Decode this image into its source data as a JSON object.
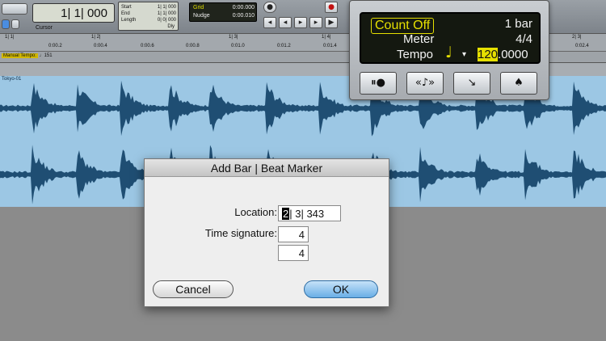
{
  "toolbar": {
    "main_counter": "1| 1| 000",
    "cursor_label": "Cursor",
    "selection": [
      {
        "label": "Start",
        "value": "1| 1| 000"
      },
      {
        "label": "End",
        "value": "1| 1| 000"
      },
      {
        "label": "Length",
        "value": "0| 0| 000"
      }
    ],
    "dly_label": "Dly",
    "grid": {
      "label": "Grid",
      "value": "0:00.000"
    },
    "nudge": {
      "label": "Nudge",
      "value": "0:00.010"
    }
  },
  "ruler": {
    "bars": [
      "1| 1|",
      "1| 2|",
      "1| 3|",
      "1| 4|",
      "2| 3|"
    ],
    "times": [
      "0:00.2",
      "0:00.4",
      "0:00.6",
      "0:00.8",
      "0:01.0",
      "0:01.2",
      "0:01.4",
      "0:02.4"
    ]
  },
  "tempo_ruler": {
    "label": "Manual Tempo:",
    "value": "151"
  },
  "track": {
    "name": "Tokyo-01"
  },
  "count_off_panel": {
    "count_off": "Count Off",
    "count_off_value": "1 bar",
    "meter_label": "Meter",
    "meter_value": "4/4",
    "tempo_label": "Tempo",
    "note_symbol": "♩",
    "dropdown_symbol": "▾",
    "tempo_int": "120",
    "tempo_frac": ".0000",
    "buttons": [
      {
        "icon": "wait-for-note-icon",
        "glyph": "⏸●"
      },
      {
        "icon": "metronome-icon",
        "glyph": "«♪»"
      },
      {
        "icon": "tempo-conductor-icon",
        "glyph": "↘"
      },
      {
        "icon": "conductor-icon",
        "glyph": "♠"
      }
    ]
  },
  "dialog": {
    "title": "Add Bar | Beat Marker",
    "location_label": "Location:",
    "location_selected": "2",
    "location_rest": "| 3| 343",
    "time_signature_label": "Time signature:",
    "numerator": "4",
    "denominator": "4",
    "cancel_label": "Cancel",
    "ok_label": "OK"
  }
}
